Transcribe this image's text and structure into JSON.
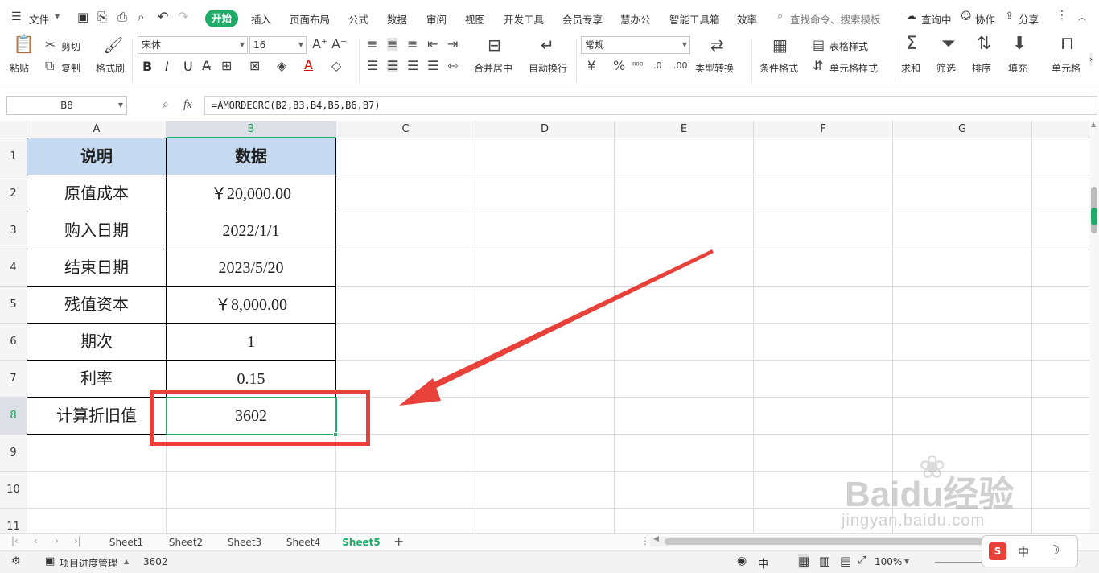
{
  "menubar": {
    "file": "文件",
    "tabs": [
      "开始",
      "插入",
      "页面布局",
      "公式",
      "数据",
      "审阅",
      "视图",
      "开发工具",
      "会员专享",
      "慧办公",
      "智能工具箱",
      "效率"
    ],
    "search_placeholder": "查找命令、搜索模板",
    "right": [
      "查询中",
      "协作",
      "分享"
    ]
  },
  "ribbon": {
    "paste": "粘贴",
    "cut": "剪切",
    "copy": "复制",
    "format_painter": "格式刷",
    "font_name": "宋体",
    "font_size": "16",
    "merge_center": "合并居中",
    "wrap_text": "自动换行",
    "number_format": "常规",
    "type_convert": "类型转换",
    "cond_format": "条件格式",
    "table_style": "表格样式",
    "cell_style": "单元格样式",
    "sum": "求和",
    "filter": "筛选",
    "sort": "排序",
    "fill": "填充",
    "cell": "单元格",
    "bold": "B",
    "italic": "I",
    "underline": "U"
  },
  "formula_bar": {
    "name_box": "B8",
    "fx": "fx",
    "formula": "=AMORDEGRC(B2,B3,B4,B5,B6,B7)"
  },
  "columns": [
    "A",
    "B",
    "C",
    "D",
    "E",
    "F",
    "G"
  ],
  "rows": [
    "1",
    "2",
    "3",
    "4",
    "5",
    "6",
    "7",
    "8",
    "9",
    "10",
    "11"
  ],
  "table": {
    "header": [
      "说明",
      "数据"
    ],
    "rows": [
      [
        "原值成本",
        "￥20,000.00"
      ],
      [
        "购入日期",
        "2022/1/1"
      ],
      [
        "结束日期",
        "2023/5/20"
      ],
      [
        "残值资本",
        "￥8,000.00"
      ],
      [
        "期次",
        "1"
      ],
      [
        "利率",
        "0.15"
      ],
      [
        "计算折旧值",
        "3602"
      ]
    ]
  },
  "sheets": [
    "Sheet1",
    "Sheet2",
    "Sheet3",
    "Sheet4",
    "Sheet5"
  ],
  "active_sheet": "Sheet5",
  "status": {
    "macro": "项目进度管理",
    "value": "3602",
    "zoom": "100%",
    "ime": "中"
  },
  "watermark": {
    "line1": "Baidu经验",
    "line2": "jingyan.baidu.com"
  },
  "colors": {
    "accent": "#1fab68",
    "header_fill": "#c5d9f1",
    "highlight_box": "#e8413a",
    "arrow": "#e8413a"
  }
}
